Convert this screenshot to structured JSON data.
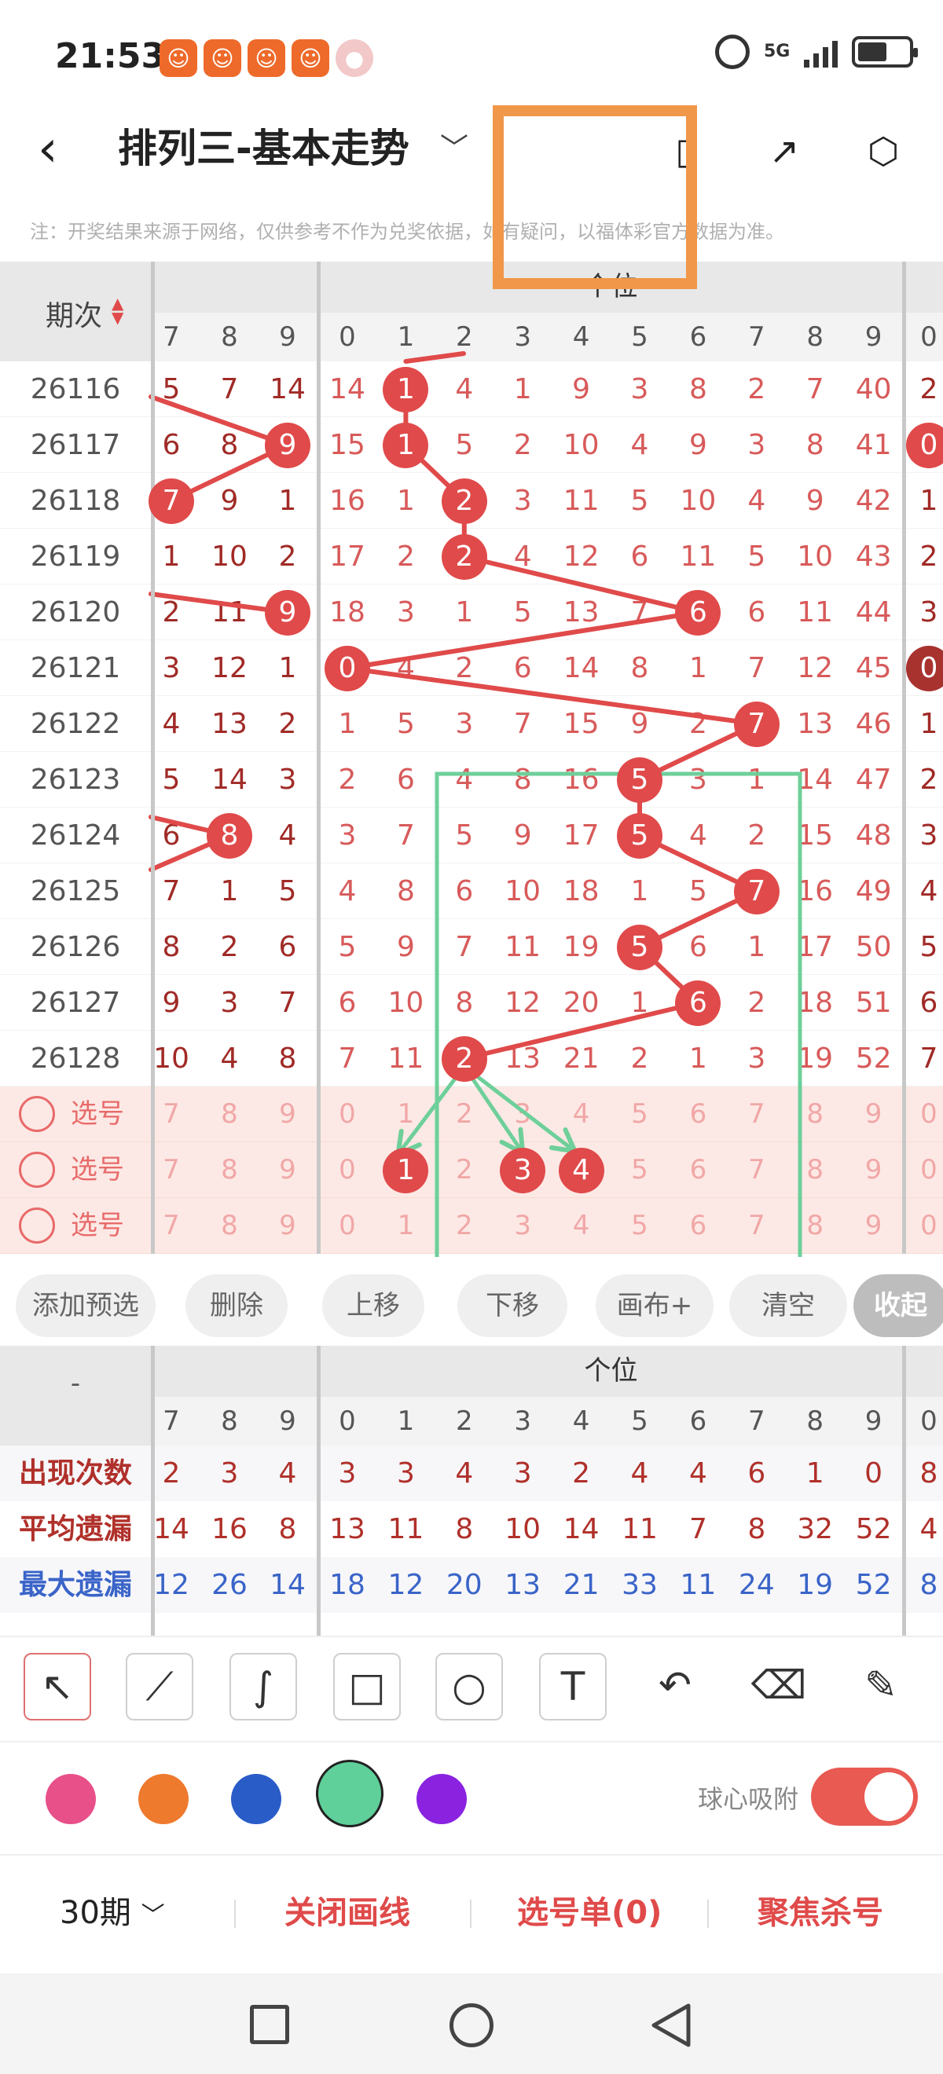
{
  "status_bar": {
    "time": "21:53",
    "network": "5G"
  },
  "header": {
    "title": "排列三-基本走势"
  },
  "notice": "注：开奖结果来源于网络，仅供参考不作为兑奖依据，如有疑问，以福体彩官方数据为准。",
  "table": {
    "issue_header": "期次",
    "section_label": "个位",
    "prev_digits": [
      "7",
      "8",
      "9"
    ],
    "digits": [
      "0",
      "1",
      "2",
      "3",
      "4",
      "5",
      "6",
      "7",
      "8",
      "9"
    ],
    "next_digit": "0",
    "rows": [
      {
        "issue": "26116",
        "prev": [
          "5",
          "7",
          "14"
        ],
        "cells": [
          "14",
          "1",
          "4",
          "1",
          "9",
          "3",
          "8",
          "2",
          "7",
          "40"
        ],
        "next": "2"
      },
      {
        "issue": "26117",
        "prev": [
          "6",
          "8",
          "9"
        ],
        "cells": [
          "15",
          "1",
          "5",
          "2",
          "10",
          "4",
          "9",
          "3",
          "8",
          "41"
        ],
        "next": "0"
      },
      {
        "issue": "26118",
        "prev": [
          "7",
          "9",
          "1"
        ],
        "cells": [
          "16",
          "1",
          "2",
          "3",
          "11",
          "5",
          "10",
          "4",
          "9",
          "42"
        ],
        "next": "1"
      },
      {
        "issue": "26119",
        "prev": [
          "1",
          "10",
          "2"
        ],
        "cells": [
          "17",
          "2",
          "2",
          "4",
          "12",
          "6",
          "11",
          "5",
          "10",
          "43"
        ],
        "next": "2"
      },
      {
        "issue": "26120",
        "prev": [
          "2",
          "11",
          "9"
        ],
        "cells": [
          "18",
          "3",
          "1",
          "5",
          "13",
          "7",
          "6",
          "6",
          "11",
          "44"
        ],
        "next": "3"
      },
      {
        "issue": "26121",
        "prev": [
          "3",
          "12",
          "1"
        ],
        "cells": [
          "0",
          "4",
          "2",
          "6",
          "14",
          "8",
          "1",
          "7",
          "12",
          "45"
        ],
        "next": "0"
      },
      {
        "issue": "26122",
        "prev": [
          "4",
          "13",
          "2"
        ],
        "cells": [
          "1",
          "5",
          "3",
          "7",
          "15",
          "9",
          "2",
          "7",
          "13",
          "46"
        ],
        "next": "1"
      },
      {
        "issue": "26123",
        "prev": [
          "5",
          "14",
          "3"
        ],
        "cells": [
          "2",
          "6",
          "4",
          "8",
          "16",
          "5",
          "3",
          "1",
          "14",
          "47"
        ],
        "next": "2"
      },
      {
        "issue": "26124",
        "prev": [
          "6",
          "8",
          "4"
        ],
        "cells": [
          "3",
          "7",
          "5",
          "9",
          "17",
          "5",
          "4",
          "2",
          "15",
          "48"
        ],
        "next": "3"
      },
      {
        "issue": "26125",
        "prev": [
          "7",
          "1",
          "5"
        ],
        "cells": [
          "4",
          "8",
          "6",
          "10",
          "18",
          "1",
          "5",
          "7",
          "16",
          "49"
        ],
        "next": "4"
      },
      {
        "issue": "26126",
        "prev": [
          "8",
          "2",
          "6"
        ],
        "cells": [
          "5",
          "9",
          "7",
          "11",
          "19",
          "5",
          "6",
          "1",
          "17",
          "50"
        ],
        "next": "5"
      },
      {
        "issue": "26127",
        "prev": [
          "9",
          "3",
          "7"
        ],
        "cells": [
          "6",
          "10",
          "8",
          "12",
          "20",
          "1",
          "6",
          "2",
          "18",
          "51"
        ],
        "next": "6"
      },
      {
        "issue": "26128",
        "prev": [
          "10",
          "4",
          "8"
        ],
        "cells": [
          "7",
          "11",
          "2",
          "13",
          "21",
          "2",
          "1",
          "3",
          "19",
          "52"
        ],
        "next": "7"
      }
    ],
    "pick_label": "选号",
    "pick_rows": [
      {
        "prev": [
          "7",
          "8",
          "9"
        ],
        "cells": [
          "0",
          "1",
          "2",
          "3",
          "4",
          "5",
          "6",
          "7",
          "8",
          "9"
        ],
        "next": "0"
      },
      {
        "prev": [
          "7",
          "8",
          "9"
        ],
        "cells": [
          "0",
          "1",
          "2",
          "3",
          "4",
          "5",
          "6",
          "7",
          "8",
          "9"
        ],
        "next": "0"
      },
      {
        "prev": [
          "7",
          "8",
          "9"
        ],
        "cells": [
          "0",
          "1",
          "2",
          "3",
          "4",
          "5",
          "6",
          "7",
          "8",
          "9"
        ],
        "next": "0"
      }
    ]
  },
  "actions": [
    "添加预选",
    "删除",
    "上移",
    "下移",
    "画布+",
    "清空",
    "收起"
  ],
  "stats": {
    "corner": "-",
    "section_label": "个位",
    "rows": [
      {
        "label": "出现次数",
        "color": "#b0302a",
        "prev": [
          "2",
          "3",
          "4"
        ],
        "cells": [
          "3",
          "3",
          "4",
          "3",
          "2",
          "4",
          "4",
          "6",
          "1",
          "0"
        ],
        "next": "8"
      },
      {
        "label": "平均遗漏",
        "color": "#b0302a",
        "prev": [
          "14",
          "16",
          "8"
        ],
        "cells": [
          "13",
          "11",
          "8",
          "10",
          "14",
          "11",
          "7",
          "8",
          "32",
          "52"
        ],
        "next": "4"
      },
      {
        "label": "最大遗漏",
        "color": "#3a64c8",
        "prev": [
          "12",
          "26",
          "14"
        ],
        "cells": [
          "18",
          "12",
          "20",
          "13",
          "21",
          "33",
          "11",
          "24",
          "19",
          "52"
        ],
        "next": "8"
      }
    ]
  },
  "tools": [
    {
      "name": "arrow-tool-icon",
      "glyph": "↖"
    },
    {
      "name": "line-tool-icon",
      "glyph": "⟋"
    },
    {
      "name": "curve-tool-icon",
      "glyph": "∫"
    },
    {
      "name": "rect-tool-icon",
      "glyph": "□"
    },
    {
      "name": "circle-tool-icon",
      "glyph": "○"
    },
    {
      "name": "text-tool-icon",
      "glyph": "T"
    },
    {
      "name": "undo-icon",
      "glyph": "↶"
    },
    {
      "name": "eraser-icon",
      "glyph": "⌫"
    },
    {
      "name": "brush-clear-icon",
      "glyph": "✎"
    }
  ],
  "colors": {
    "accent": "#e04a4a",
    "pink": "#e8508a",
    "orange": "#ee7a2e",
    "blue": "#2a5cc8",
    "green": "#5fd09a",
    "purple": "#8a22e0",
    "highlight_box": "#f0974a",
    "draw_box": "#6ecf9a"
  },
  "snap": {
    "label": "球心吸附",
    "on": true
  },
  "bottom": {
    "period": "30期",
    "close_lines": "关闭画线",
    "pick_list": "选号单(0)",
    "focus_kill": "聚焦杀号"
  }
}
